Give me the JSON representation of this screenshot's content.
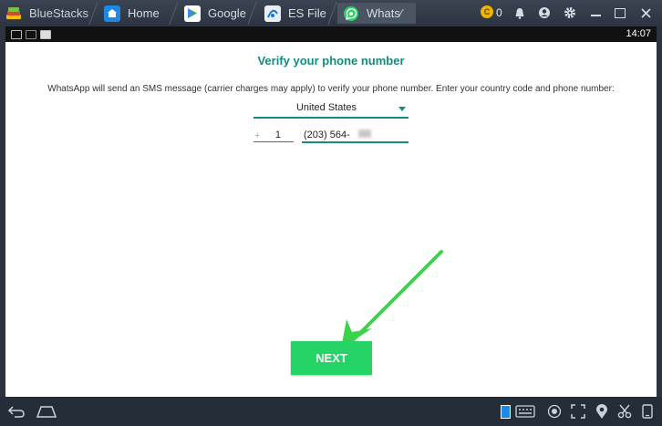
{
  "titlebar": {
    "brand": "BlueStacks",
    "tabs": [
      {
        "label": "Home",
        "icon": "home-icon"
      },
      {
        "label": "Google",
        "icon": "play-store-icon"
      },
      {
        "label": "ES File",
        "icon": "es-file-icon"
      },
      {
        "label": "Whats⁄",
        "icon": "whatsapp-icon"
      }
    ],
    "coin_count": "0",
    "colors": {
      "bar": "#2c3440",
      "active_tab": "#4a5462"
    }
  },
  "statusbar": {
    "time": "14:07"
  },
  "app": {
    "heading": "Verify your phone number",
    "description": "WhatsApp will send an SMS message (carrier charges may apply) to verify your phone number. Enter your country code and phone number:",
    "country": "United States",
    "plus": "+",
    "country_code": "1",
    "phone_number": "(203) 564-",
    "next_label": "NEXT",
    "colors": {
      "accent": "#128c7e",
      "button": "#25d366",
      "arrow": "#3bd34a"
    }
  }
}
